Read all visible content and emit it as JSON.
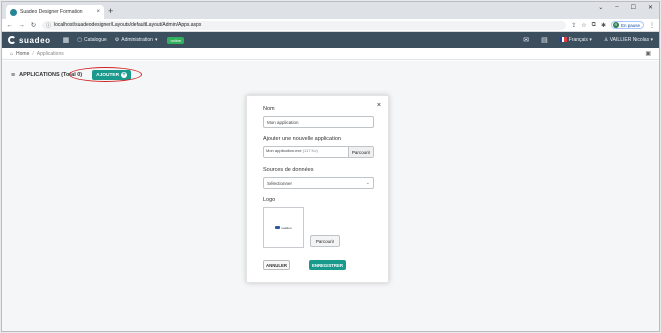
{
  "browser": {
    "tab_title": "Suadeo Designer Formation",
    "tab_close": "×",
    "new_tab": "+",
    "window_controls": [
      "⌄",
      "–",
      "☐",
      "✕"
    ],
    "url": "localhost/suadeodesigner/Layouts/defaultLayout/Admin/Apps.aspx",
    "profile_initial": "R",
    "profile_status": "En pause"
  },
  "appbar": {
    "brand": "suadeo",
    "menu": [
      {
        "label": "Catalogue",
        "icon": "catalog-icon"
      },
      {
        "label": "Administration",
        "icon": "gear-icon"
      }
    ],
    "status_badge": "online",
    "language": "Français",
    "user": "VAILLIER Nicolas"
  },
  "breadcrumb": {
    "home": "Home",
    "separator": "/",
    "current": "Applications"
  },
  "page": {
    "title": "APPLICATIONS (Total 0)",
    "add_button": "AJOUTER",
    "add_icon": "+"
  },
  "modal": {
    "close": "×",
    "name_label": "Nom",
    "name_value": "Mon application",
    "add_app_label": "Ajouter une nouvelle application",
    "file_value": "Mon application.exe",
    "file_hint": "(117 Ko)",
    "browse_label": "Parcourir",
    "sources_label": "Sources de données",
    "sources_value": "Sélectionner",
    "logo_label": "Logo",
    "logo_browse_label": "Parcourir",
    "logo_thumb_text": "suadeo",
    "cancel_label": "ANNULER",
    "save_label": "ENREGISTRER"
  },
  "colors": {
    "appbar": "#3c4f5f",
    "accent": "#1a9a8c",
    "annotation": "#d02424",
    "online": "#32b05e"
  }
}
